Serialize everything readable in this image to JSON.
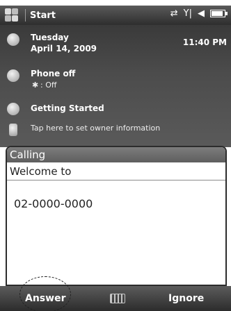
{
  "titlebar": {
    "title": "Start",
    "icons": [
      "windows-flag-icon",
      "sync-icon",
      "signal-icon",
      "speaker-icon",
      "battery-icon"
    ]
  },
  "today": {
    "date_line1": "Tuesday",
    "date_line2": "April 14, 2009",
    "time": "11:40 PM",
    "phone_title": "Phone off",
    "bluetooth_status": ": Off",
    "getting_started": "Getting Started",
    "owner_info": "Tap here to set owner information"
  },
  "dialog": {
    "title": "Calling",
    "message": "Welcome to",
    "number": "02-0000-0000"
  },
  "softkeys": {
    "left": "Answer",
    "right": "Ignore"
  },
  "colors": {
    "titlebar": "#3a3a3a",
    "dialog_title": "#6e6e6e",
    "softbar": "#3a3a3a"
  }
}
